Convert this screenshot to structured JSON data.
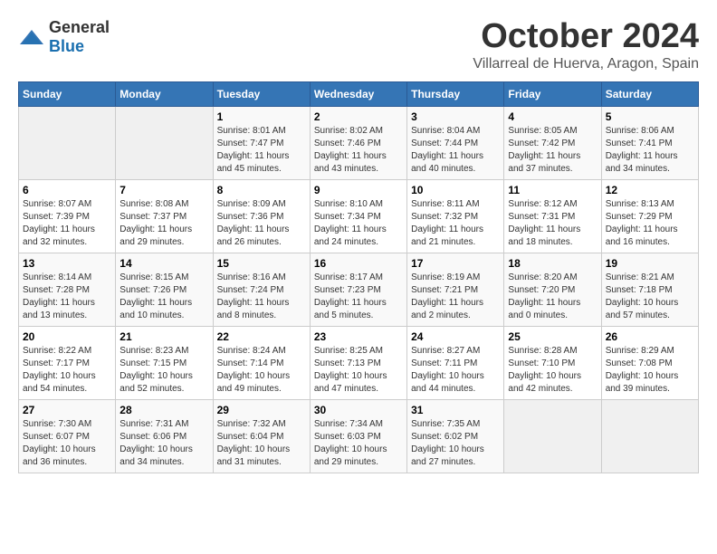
{
  "header": {
    "logo_general": "General",
    "logo_blue": "Blue",
    "month_title": "October 2024",
    "location": "Villarreal de Huerva, Aragon, Spain"
  },
  "weekdays": [
    "Sunday",
    "Monday",
    "Tuesday",
    "Wednesday",
    "Thursday",
    "Friday",
    "Saturday"
  ],
  "weeks": [
    [
      {
        "day": "",
        "sunrise": "",
        "sunset": "",
        "daylight": ""
      },
      {
        "day": "",
        "sunrise": "",
        "sunset": "",
        "daylight": ""
      },
      {
        "day": "1",
        "sunrise": "Sunrise: 8:01 AM",
        "sunset": "Sunset: 7:47 PM",
        "daylight": "Daylight: 11 hours and 45 minutes."
      },
      {
        "day": "2",
        "sunrise": "Sunrise: 8:02 AM",
        "sunset": "Sunset: 7:46 PM",
        "daylight": "Daylight: 11 hours and 43 minutes."
      },
      {
        "day": "3",
        "sunrise": "Sunrise: 8:04 AM",
        "sunset": "Sunset: 7:44 PM",
        "daylight": "Daylight: 11 hours and 40 minutes."
      },
      {
        "day": "4",
        "sunrise": "Sunrise: 8:05 AM",
        "sunset": "Sunset: 7:42 PM",
        "daylight": "Daylight: 11 hours and 37 minutes."
      },
      {
        "day": "5",
        "sunrise": "Sunrise: 8:06 AM",
        "sunset": "Sunset: 7:41 PM",
        "daylight": "Daylight: 11 hours and 34 minutes."
      }
    ],
    [
      {
        "day": "6",
        "sunrise": "Sunrise: 8:07 AM",
        "sunset": "Sunset: 7:39 PM",
        "daylight": "Daylight: 11 hours and 32 minutes."
      },
      {
        "day": "7",
        "sunrise": "Sunrise: 8:08 AM",
        "sunset": "Sunset: 7:37 PM",
        "daylight": "Daylight: 11 hours and 29 minutes."
      },
      {
        "day": "8",
        "sunrise": "Sunrise: 8:09 AM",
        "sunset": "Sunset: 7:36 PM",
        "daylight": "Daylight: 11 hours and 26 minutes."
      },
      {
        "day": "9",
        "sunrise": "Sunrise: 8:10 AM",
        "sunset": "Sunset: 7:34 PM",
        "daylight": "Daylight: 11 hours and 24 minutes."
      },
      {
        "day": "10",
        "sunrise": "Sunrise: 8:11 AM",
        "sunset": "Sunset: 7:32 PM",
        "daylight": "Daylight: 11 hours and 21 minutes."
      },
      {
        "day": "11",
        "sunrise": "Sunrise: 8:12 AM",
        "sunset": "Sunset: 7:31 PM",
        "daylight": "Daylight: 11 hours and 18 minutes."
      },
      {
        "day": "12",
        "sunrise": "Sunrise: 8:13 AM",
        "sunset": "Sunset: 7:29 PM",
        "daylight": "Daylight: 11 hours and 16 minutes."
      }
    ],
    [
      {
        "day": "13",
        "sunrise": "Sunrise: 8:14 AM",
        "sunset": "Sunset: 7:28 PM",
        "daylight": "Daylight: 11 hours and 13 minutes."
      },
      {
        "day": "14",
        "sunrise": "Sunrise: 8:15 AM",
        "sunset": "Sunset: 7:26 PM",
        "daylight": "Daylight: 11 hours and 10 minutes."
      },
      {
        "day": "15",
        "sunrise": "Sunrise: 8:16 AM",
        "sunset": "Sunset: 7:24 PM",
        "daylight": "Daylight: 11 hours and 8 minutes."
      },
      {
        "day": "16",
        "sunrise": "Sunrise: 8:17 AM",
        "sunset": "Sunset: 7:23 PM",
        "daylight": "Daylight: 11 hours and 5 minutes."
      },
      {
        "day": "17",
        "sunrise": "Sunrise: 8:19 AM",
        "sunset": "Sunset: 7:21 PM",
        "daylight": "Daylight: 11 hours and 2 minutes."
      },
      {
        "day": "18",
        "sunrise": "Sunrise: 8:20 AM",
        "sunset": "Sunset: 7:20 PM",
        "daylight": "Daylight: 11 hours and 0 minutes."
      },
      {
        "day": "19",
        "sunrise": "Sunrise: 8:21 AM",
        "sunset": "Sunset: 7:18 PM",
        "daylight": "Daylight: 10 hours and 57 minutes."
      }
    ],
    [
      {
        "day": "20",
        "sunrise": "Sunrise: 8:22 AM",
        "sunset": "Sunset: 7:17 PM",
        "daylight": "Daylight: 10 hours and 54 minutes."
      },
      {
        "day": "21",
        "sunrise": "Sunrise: 8:23 AM",
        "sunset": "Sunset: 7:15 PM",
        "daylight": "Daylight: 10 hours and 52 minutes."
      },
      {
        "day": "22",
        "sunrise": "Sunrise: 8:24 AM",
        "sunset": "Sunset: 7:14 PM",
        "daylight": "Daylight: 10 hours and 49 minutes."
      },
      {
        "day": "23",
        "sunrise": "Sunrise: 8:25 AM",
        "sunset": "Sunset: 7:13 PM",
        "daylight": "Daylight: 10 hours and 47 minutes."
      },
      {
        "day": "24",
        "sunrise": "Sunrise: 8:27 AM",
        "sunset": "Sunset: 7:11 PM",
        "daylight": "Daylight: 10 hours and 44 minutes."
      },
      {
        "day": "25",
        "sunrise": "Sunrise: 8:28 AM",
        "sunset": "Sunset: 7:10 PM",
        "daylight": "Daylight: 10 hours and 42 minutes."
      },
      {
        "day": "26",
        "sunrise": "Sunrise: 8:29 AM",
        "sunset": "Sunset: 7:08 PM",
        "daylight": "Daylight: 10 hours and 39 minutes."
      }
    ],
    [
      {
        "day": "27",
        "sunrise": "Sunrise: 7:30 AM",
        "sunset": "Sunset: 6:07 PM",
        "daylight": "Daylight: 10 hours and 36 minutes."
      },
      {
        "day": "28",
        "sunrise": "Sunrise: 7:31 AM",
        "sunset": "Sunset: 6:06 PM",
        "daylight": "Daylight: 10 hours and 34 minutes."
      },
      {
        "day": "29",
        "sunrise": "Sunrise: 7:32 AM",
        "sunset": "Sunset: 6:04 PM",
        "daylight": "Daylight: 10 hours and 31 minutes."
      },
      {
        "day": "30",
        "sunrise": "Sunrise: 7:34 AM",
        "sunset": "Sunset: 6:03 PM",
        "daylight": "Daylight: 10 hours and 29 minutes."
      },
      {
        "day": "31",
        "sunrise": "Sunrise: 7:35 AM",
        "sunset": "Sunset: 6:02 PM",
        "daylight": "Daylight: 10 hours and 27 minutes."
      },
      {
        "day": "",
        "sunrise": "",
        "sunset": "",
        "daylight": ""
      },
      {
        "day": "",
        "sunrise": "",
        "sunset": "",
        "daylight": ""
      }
    ]
  ]
}
